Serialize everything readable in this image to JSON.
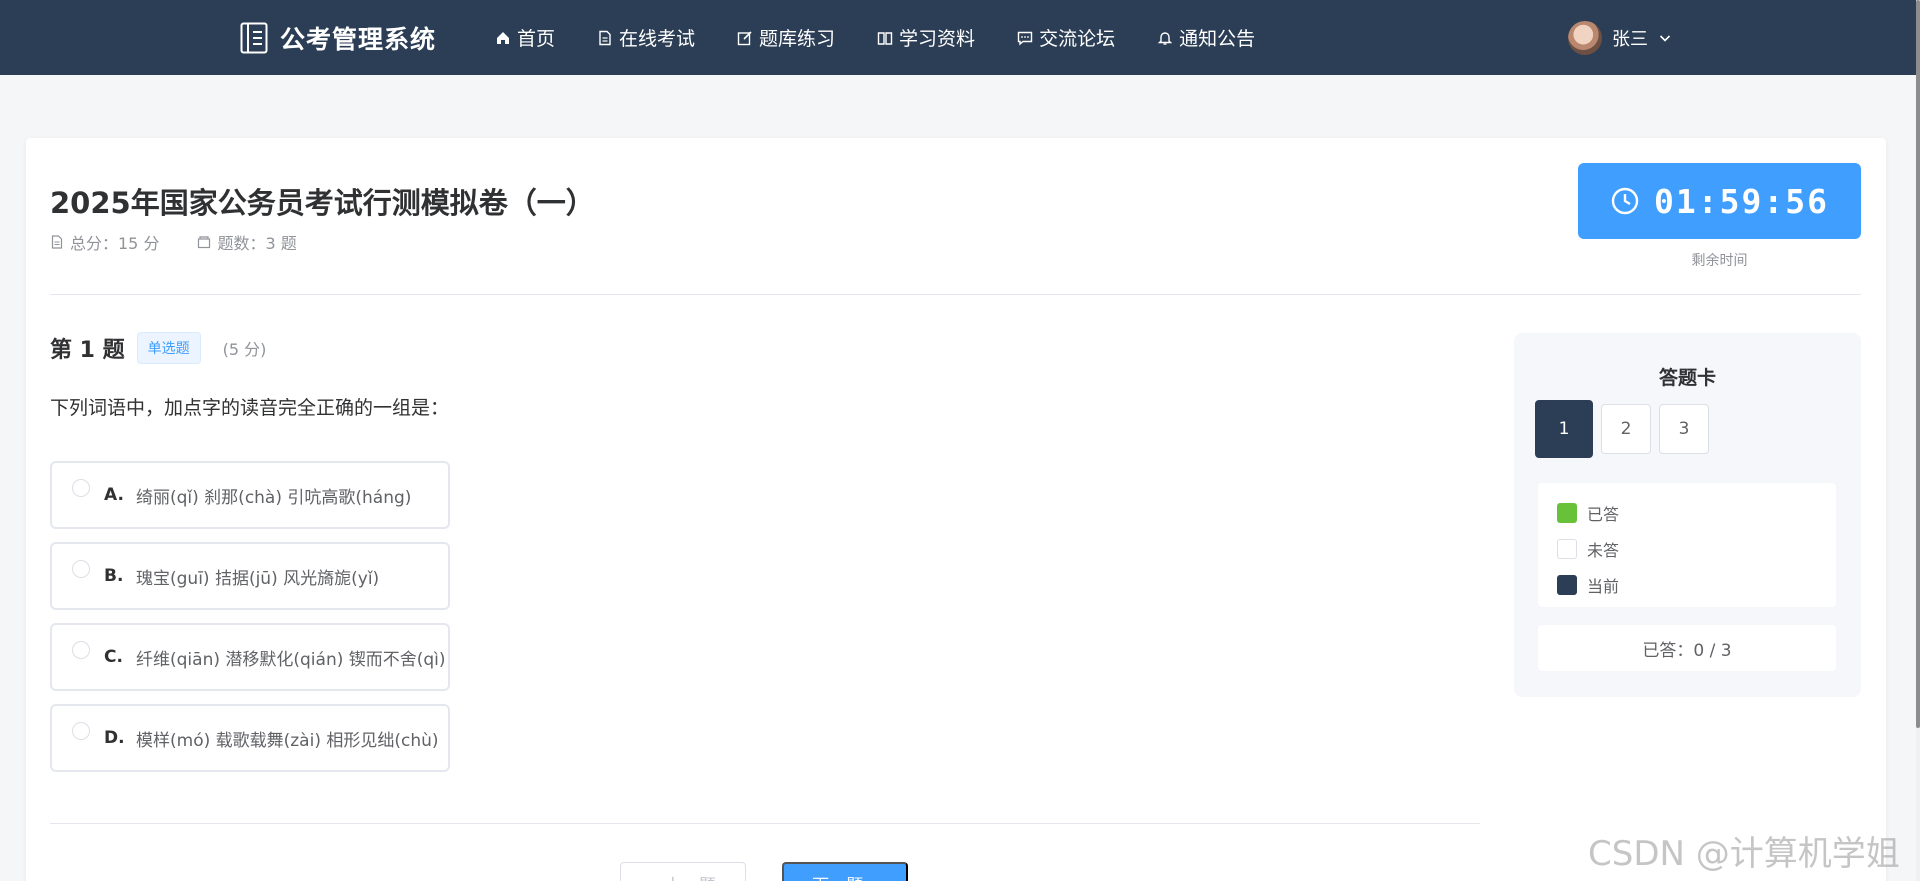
{
  "app": {
    "title": "公考管理系统",
    "nav": [
      {
        "label": "首页",
        "icon": "home-icon"
      },
      {
        "label": "在线考试",
        "icon": "document-icon"
      },
      {
        "label": "题库练习",
        "icon": "edit-icon"
      },
      {
        "label": "学习资料",
        "icon": "book-icon"
      },
      {
        "label": "交流论坛",
        "icon": "chat-icon"
      },
      {
        "label": "通知公告",
        "icon": "bell-icon"
      }
    ],
    "user": {
      "name": "张三"
    }
  },
  "exam": {
    "title": "2025年国家公务员考试行测模拟卷（一）",
    "total_score": "总分：15 分",
    "question_count": "题数：3 题",
    "timer": "01:59:56",
    "timer_label": "剩余时间"
  },
  "question": {
    "number": "第 1 题",
    "type": "单选题",
    "score": "(5 分)",
    "text": "下列词语中，加点字的读音完全正确的一组是：",
    "options": [
      {
        "letter": "A.",
        "text": "绮丽(qǐ) 刹那(chà) 引吭高歌(háng)"
      },
      {
        "letter": "B.",
        "text": "瑰宝(guī) 拮据(jū) 风光旖旎(yǐ)"
      },
      {
        "letter": "C.",
        "text": "纤维(qiān) 潜移默化(qián) 锲而不舍(qì)"
      },
      {
        "letter": "D.",
        "text": "模样(mó) 载歌载舞(zài) 相形见绌(chù)"
      }
    ],
    "prev_label": "< 上一题",
    "next_label": "下一题 >"
  },
  "answer_card": {
    "title": "答题卡",
    "cells": [
      "1",
      "2",
      "3"
    ],
    "current_index": 0,
    "legend": [
      {
        "label": "已答",
        "color": "#67c23a"
      },
      {
        "label": "未答",
        "color": "#ffffff"
      },
      {
        "label": "当前",
        "color": "#2c3e55"
      }
    ],
    "progress": "已答：0 / 3"
  },
  "watermark": "CSDN @计算机学姐",
  "colors": {
    "nav_bg": "#2c3e55",
    "primary": "#409eff",
    "answered": "#67c23a"
  }
}
